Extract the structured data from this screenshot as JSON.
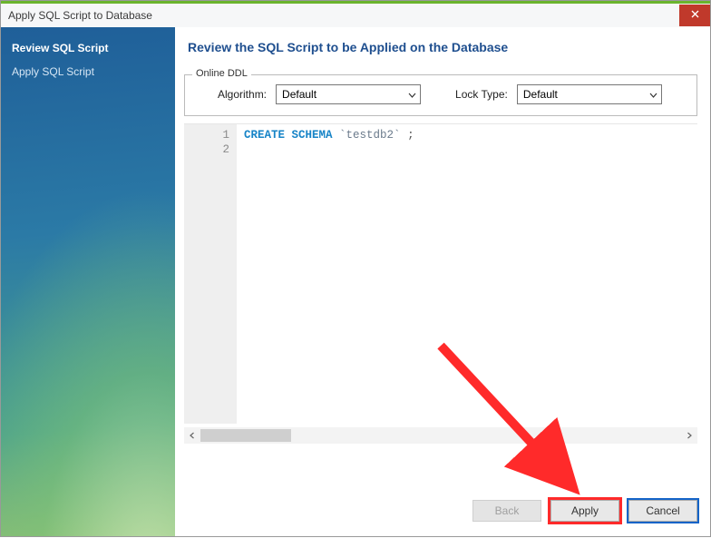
{
  "window": {
    "title": "Apply SQL Script to Database"
  },
  "sidebar": {
    "steps": [
      {
        "label": "Review SQL Script",
        "selected": true
      },
      {
        "label": "Apply SQL Script",
        "selected": false
      }
    ]
  },
  "main": {
    "heading": "Review the SQL Script to be Applied on the Database",
    "group_legend": "Online DDL",
    "algorithm_label": "Algorithm:",
    "algorithm_value": "Default",
    "locktype_label": "Lock Type:",
    "locktype_value": "Default"
  },
  "editor": {
    "line_numbers": [
      "1",
      "2"
    ],
    "code": {
      "keyword": "CREATE SCHEMA",
      "identifier": "`testdb2`",
      "terminator": ";"
    }
  },
  "footer": {
    "back_label": "Back",
    "apply_label": "Apply",
    "cancel_label": "Cancel"
  },
  "annotations": {
    "highlight_apply": true,
    "highlight_cancel": true,
    "arrow_to_apply": true
  }
}
